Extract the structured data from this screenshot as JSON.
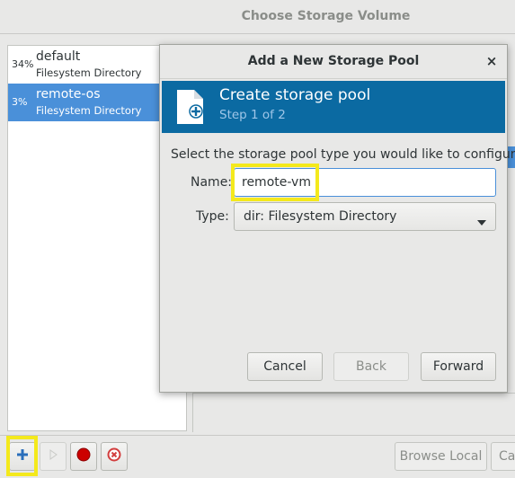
{
  "window": {
    "title": "Choose Storage Volume"
  },
  "pools": [
    {
      "percent": "34%",
      "name": "default",
      "type": "Filesystem Directory",
      "selected": false
    },
    {
      "percent": "3%",
      "name": "remote-os",
      "type": "Filesystem Directory",
      "selected": true
    }
  ],
  "toolbar": {
    "add_icon": "plus-icon",
    "start_icon": "play-icon",
    "stop_icon": "record-icon",
    "delete_icon": "delete-circle-icon",
    "browse_local_label": "Browse Local",
    "cancel_label": "Ca"
  },
  "dialog": {
    "title": "Add a New Storage Pool",
    "close_label": "×",
    "banner": {
      "title": "Create storage pool",
      "step": "Step 1 of 2",
      "icon": "new-file-icon"
    },
    "instruction": "Select the storage pool type you would like to configure.",
    "name_label": "Name:",
    "name_value": "remote-vm",
    "type_label": "Type:",
    "type_value": "dir: Filesystem Directory",
    "buttons": {
      "cancel": "Cancel",
      "back": "Back",
      "forward": "Forward"
    }
  },
  "colors": {
    "selection": "#4a90d9",
    "banner": "#0b6aa2",
    "highlight": "#f4e91c",
    "add_icon": "#2a6ebb",
    "stop_icon": "#cc0000",
    "delete_icon": "#d23e3e"
  }
}
